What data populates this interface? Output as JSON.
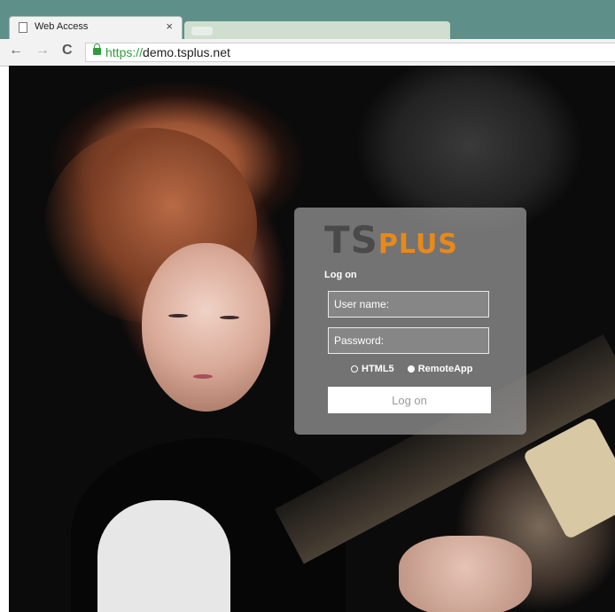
{
  "browser": {
    "tab_title": "Web Access",
    "tab_close": "×",
    "nav": {
      "back": "←",
      "forward": "→",
      "reload": "C"
    },
    "url_scheme": "https://",
    "url_host": "demo.tsplus.net"
  },
  "login": {
    "logo_ts": "TS",
    "logo_plus": "PLUS",
    "heading": "Log on",
    "username_placeholder": "User name:",
    "password_placeholder": "Password:",
    "options": [
      "HTML5",
      "RemoteApp"
    ],
    "selected_option": "HTML5",
    "button_label": "Log on"
  },
  "colors": {
    "accent": "#e8891a",
    "secure": "#2e9e3c"
  }
}
